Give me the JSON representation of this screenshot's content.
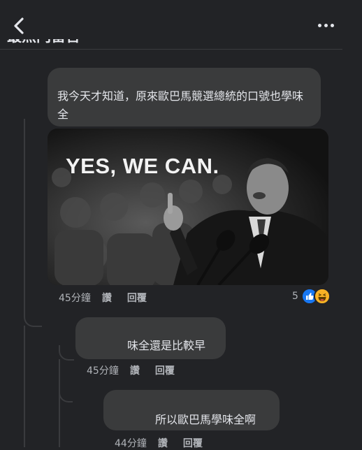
{
  "header": {
    "section_title": "最熱門留言"
  },
  "comments": [
    {
      "text": "我今天才知道，原來歐巴馬競選總統的口號也學味全",
      "image_caption": "YES, WE CAN.",
      "time": "45分鐘",
      "like_label": "讚",
      "reply_label": "回覆",
      "reaction_count": "5",
      "reactions": [
        "like-icon",
        "haha-icon"
      ]
    },
    {
      "text": "味全還是比較早",
      "time": "45分鐘",
      "like_label": "讚",
      "reply_label": "回覆"
    },
    {
      "text": "所以歐巴馬學味全啊",
      "time": "44分鐘",
      "like_label": "讚",
      "reply_label": "回覆"
    }
  ],
  "colors": {
    "background": "#222326",
    "bubble": "#3a3b3c",
    "meta_text": "#b0b3b8",
    "like_blue": "#1877f2",
    "haha_yellow": "#f7b125"
  }
}
